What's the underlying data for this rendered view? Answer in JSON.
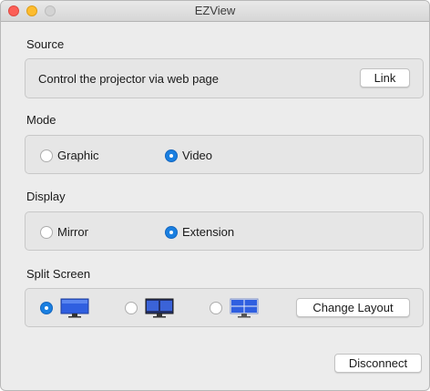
{
  "window": {
    "title": "EZView"
  },
  "source": {
    "label": "Source",
    "text": "Control the projector via web page",
    "link_button": "Link"
  },
  "mode": {
    "label": "Mode",
    "options": [
      {
        "label": "Graphic",
        "selected": false
      },
      {
        "label": "Video",
        "selected": true
      }
    ]
  },
  "display": {
    "label": "Display",
    "options": [
      {
        "label": "Mirror",
        "selected": false
      },
      {
        "label": "Extension",
        "selected": true
      }
    ]
  },
  "split_screen": {
    "label": "Split Screen",
    "layouts": [
      {
        "icon": "single-screen-icon",
        "selected": true
      },
      {
        "icon": "dual-screen-icon",
        "selected": false
      },
      {
        "icon": "quad-screen-icon",
        "selected": false
      }
    ],
    "change_layout_button": "Change Layout"
  },
  "footer": {
    "disconnect_button": "Disconnect"
  },
  "colors": {
    "accent": "#1a7fe0",
    "screen_blue": "#2f5fe0"
  }
}
